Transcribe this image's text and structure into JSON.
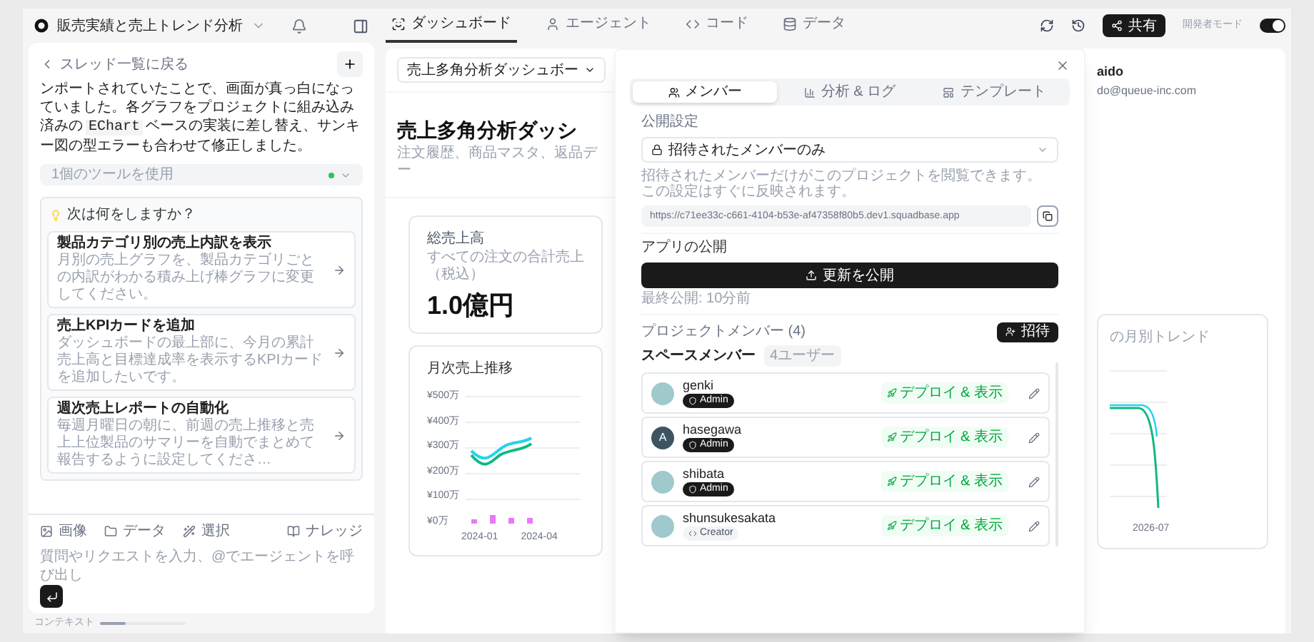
{
  "sidebar": {
    "project_title": "販売実績と売上トレンド分析",
    "back_link": "スレッド一覧に戻る",
    "message": {
      "before": "ンポートされていたことで、画面が真っ白になっていました。各グラフをプロジェクトに組み込み済みの",
      "code": "EChart",
      "after": "ベースの実装に差し替え、サンキー図の型エラーも合わせて修正しました。"
    },
    "tool_usage": {
      "label": "1個のツールを使用",
      "color": "#22c55e"
    },
    "suggestions_title": "次は何をしますか？",
    "suggestions": [
      {
        "title": "製品カテゴリ別の売上内訳を表示",
        "description": "月別の売上グラフを、製品カテゴリごとの内訳がわかる積み上げ棒グラフに変更してください。"
      },
      {
        "title": "売上KPIカードを追加",
        "description": "ダッシュボードの最上部に、今月の累計売上高と目標達成率を表示するKPIカードを追加したいです。"
      },
      {
        "title": "週次売上レポートの自動化",
        "description": "毎週月曜日の朝に、前週の売上推移と売上上位製品のサマリーを自動でまとめて報告するように設定してくださ…"
      }
    ],
    "toolbar": [
      {
        "kind": "image",
        "label": "画像"
      },
      {
        "kind": "data",
        "label": "データ"
      },
      {
        "kind": "select",
        "label": "選択"
      }
    ],
    "knowledge": "ナレッジ",
    "input_placeholder": "質問やリクエストを入力、@でエージェントを呼び出し",
    "context": {
      "label": "コンテキスト",
      "level": 0.3
    }
  },
  "tabs": [
    {
      "kind": "dashboard",
      "label": "ダッシュボード",
      "selected": true
    },
    {
      "kind": "agent",
      "label": "エージェント",
      "selected": false
    },
    {
      "kind": "code",
      "label": "コード",
      "selected": false
    },
    {
      "kind": "data",
      "label": "データ",
      "selected": false
    }
  ],
  "toolbar_right": {
    "share": "共有",
    "dev_mode": {
      "label": "開発者モード",
      "on": true
    }
  },
  "dashboard": {
    "selector": "売上多角分析ダッシュボー",
    "title": "売上多角分析ダッシ",
    "subtitle": "注文履歴、商品マスタ、返品デー",
    "kpi": {
      "label": "総売上高",
      "caption": "すべての注文の合計売上（税込）",
      "value": "1.0億円"
    },
    "chart_title": "月次売上推移",
    "yticks": [
      "¥500万",
      "¥400万",
      "¥300万",
      "¥200万",
      "¥100万",
      "¥0万"
    ],
    "xticks": [
      "2024-01",
      "2024-04"
    ],
    "user_name": "aido",
    "user_email": "do@queue-inc.com",
    "trend_title": "の月別トレンド",
    "trend_xtick": "2026-07"
  },
  "share_dialog": {
    "tabs": [
      {
        "kind": "members",
        "label": "メンバー",
        "selected": true
      },
      {
        "kind": "analytics",
        "label": "分析 & ログ",
        "selected": false
      },
      {
        "kind": "template",
        "label": "テンプレート",
        "selected": false
      }
    ],
    "visibility_label": "公開設定",
    "visibility": "招待されたメンバーのみ",
    "visibility_help": [
      "招待されたメンバーだけがこのプロジェクトを閲覧できます。",
      "この設定はすぐに反映されます。"
    ],
    "url": "https://c71ee33c-c661-4104-b53e-af47358f80b5.dev1.squadbase.app",
    "publish_title": "アプリの公開",
    "publish_button": "更新を公開",
    "last_published": "最終公開: 10分前",
    "members_title": "プロジェクトメンバー (4)",
    "invite": "招待",
    "space_members": "スペースメンバー",
    "user_count": "4ユーザー",
    "members": [
      {
        "name": "genki",
        "avatar": {
          "kind": "photo"
        },
        "role": {
          "kind": "admin",
          "label": "Admin"
        },
        "permission": "デプロイ & 表示"
      },
      {
        "name": "hasegawa",
        "avatar": {
          "kind": "letter",
          "initial": "A"
        },
        "role": {
          "kind": "admin",
          "label": "Admin"
        },
        "permission": "デプロイ & 表示"
      },
      {
        "name": "shibata",
        "avatar": {
          "kind": "photo"
        },
        "role": {
          "kind": "admin",
          "label": "Admin"
        },
        "permission": "デプロイ & 表示"
      },
      {
        "name": "shunsukesakata",
        "avatar": {
          "kind": "photo"
        },
        "role": {
          "kind": "creator",
          "label": "Creator"
        },
        "permission": "デプロイ & 表示"
      }
    ]
  }
}
